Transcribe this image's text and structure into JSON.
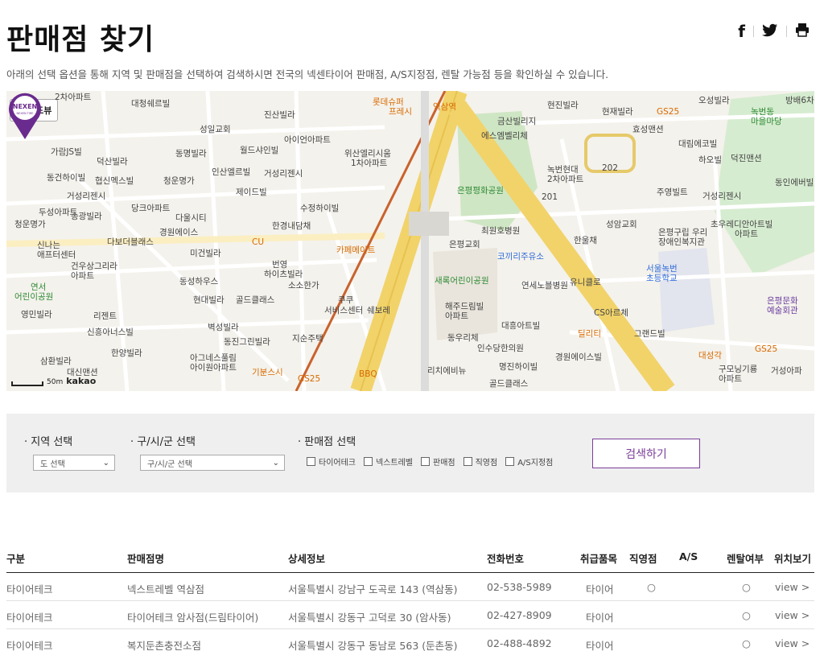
{
  "page": {
    "title": "판매점 찾기",
    "description": "아래의 선택 옵션을 통해 지역 및 판매점을 선택하여 검색하시면 전국의 넥센타이어 판매점, A/S지정점, 렌탈 가능점 등을 확인하실 수 있습니다."
  },
  "share": {
    "facebook": "f",
    "twitter": "🐦",
    "print": "🖶"
  },
  "map": {
    "roadview_label": "로드뷰",
    "scale_text": "50m",
    "map_logo": "kakao",
    "marker_brand": "NEXEN",
    "marker_sub": "NEXEN TIRE",
    "labels": [
      {
        "t": "2차아파트",
        "c": ""
      },
      {
        "t": "대청쉐르빌",
        "c": ""
      },
      {
        "t": "롯데슈퍼",
        "c": "orange"
      },
      {
        "t": "프레시",
        "c": "orange"
      },
      {
        "t": "역삼역",
        "c": "orange"
      },
      {
        "t": "현진빌라",
        "c": ""
      },
      {
        "t": "현재빌라",
        "c": ""
      },
      {
        "t": "GS25",
        "c": "orange"
      },
      {
        "t": "오성빌라",
        "c": ""
      },
      {
        "t": "녹번동",
        "c": "green"
      },
      {
        "t": "마을마당",
        "c": "green"
      },
      {
        "t": "방배6차",
        "c": ""
      },
      {
        "t": "성일교회",
        "c": ""
      },
      {
        "t": "진산빌라",
        "c": ""
      },
      {
        "t": "금산빌리지",
        "c": ""
      },
      {
        "t": "에스엠벨리체",
        "c": ""
      },
      {
        "t": "효성맨션",
        "c": ""
      },
      {
        "t": "대림에코빌",
        "c": ""
      },
      {
        "t": "가람JS빌",
        "c": ""
      },
      {
        "t": "덕산빌라",
        "c": ""
      },
      {
        "t": "동명빌라",
        "c": ""
      },
      {
        "t": "월드샤인빌",
        "c": ""
      },
      {
        "t": "아이언아파트",
        "c": ""
      },
      {
        "t": "위산엘리시움",
        "c": ""
      },
      {
        "t": "1차아파트",
        "c": ""
      },
      {
        "t": "하오빌",
        "c": ""
      },
      {
        "t": "덕진맨션",
        "c": ""
      },
      {
        "t": "동건하이빌",
        "c": ""
      },
      {
        "t": "협신멕스빌",
        "c": ""
      },
      {
        "t": "청운명가",
        "c": ""
      },
      {
        "t": "인산엘르빌",
        "c": ""
      },
      {
        "t": "거성리젠시",
        "c": ""
      },
      {
        "t": "제이드빌",
        "c": ""
      },
      {
        "t": "은평평화공원",
        "c": "green"
      },
      {
        "t": "녹번현대",
        "c": ""
      },
      {
        "t": "2차아파트",
        "c": ""
      },
      {
        "t": "주영빌트",
        "c": ""
      },
      {
        "t": "거성리젠시",
        "c": ""
      },
      {
        "t": "동인에버빌",
        "c": ""
      },
      {
        "t": "거성리젠시",
        "c": ""
      },
      {
        "t": "두성아파트",
        "c": ""
      },
      {
        "t": "당크아파트",
        "c": ""
      },
      {
        "t": "수정하이빌",
        "c": ""
      },
      {
        "t": "송광빌라",
        "c": ""
      },
      {
        "t": "다울시티",
        "c": ""
      },
      {
        "t": "청운명가",
        "c": ""
      },
      {
        "t": "경원에이스",
        "c": ""
      },
      {
        "t": "한경내담채",
        "c": ""
      },
      {
        "t": "최원호병원",
        "c": ""
      },
      {
        "t": "성암교회",
        "c": ""
      },
      {
        "t": "은평구립 우리",
        "c": ""
      },
      {
        "t": "장애인복지관",
        "c": ""
      },
      {
        "t": "초우레디안아트빌",
        "c": ""
      },
      {
        "t": "아파트",
        "c": ""
      },
      {
        "t": "신나는",
        "c": ""
      },
      {
        "t": "애프터센터",
        "c": ""
      },
      {
        "t": "다보더블래스",
        "c": ""
      },
      {
        "t": "CU",
        "c": "orange"
      },
      {
        "t": "카페메이트",
        "c": "orange"
      },
      {
        "t": "은평교회",
        "c": ""
      },
      {
        "t": "한울채",
        "c": ""
      },
      {
        "t": "미건빌라",
        "c": ""
      },
      {
        "t": "코끼리주유소",
        "c": "blue"
      },
      {
        "t": "건우상그리라",
        "c": ""
      },
      {
        "t": "아파트",
        "c": ""
      },
      {
        "t": "번영",
        "c": ""
      },
      {
        "t": "하이츠빌라",
        "c": ""
      },
      {
        "t": "서울녹번",
        "c": "blue"
      },
      {
        "t": "초등학교",
        "c": "blue"
      },
      {
        "t": "연서",
        "c": "green"
      },
      {
        "t": "어린이공원",
        "c": "green"
      },
      {
        "t": "동성하우스",
        "c": ""
      },
      {
        "t": "소소한가",
        "c": ""
      },
      {
        "t": "새록어린이공원",
        "c": "green"
      },
      {
        "t": "연세노블병원",
        "c": ""
      },
      {
        "t": "유니클로",
        "c": ""
      },
      {
        "t": "은평문화",
        "c": "purple"
      },
      {
        "t": "예술회관",
        "c": "purple"
      },
      {
        "t": "영민빌라",
        "c": ""
      },
      {
        "t": "현대빌라",
        "c": ""
      },
      {
        "t": "골드클래스",
        "c": ""
      },
      {
        "t": "쿠쿠",
        "c": ""
      },
      {
        "t": "서비스센터",
        "c": ""
      },
      {
        "t": "쉐보레",
        "c": ""
      },
      {
        "t": "해주드림빌",
        "c": ""
      },
      {
        "t": "아파트",
        "c": ""
      },
      {
        "t": "CS아르체",
        "c": ""
      },
      {
        "t": "리젠트",
        "c": ""
      },
      {
        "t": "벽성빌라",
        "c": ""
      },
      {
        "t": "대흥아트빌",
        "c": ""
      },
      {
        "t": "신흥아너스빌",
        "c": ""
      },
      {
        "t": "동진그린빌라",
        "c": ""
      },
      {
        "t": "지순주택",
        "c": ""
      },
      {
        "t": "동우리체",
        "c": ""
      },
      {
        "t": "딜리티",
        "c": "orange"
      },
      {
        "t": "그랜드빌",
        "c": ""
      },
      {
        "t": "삼환빌라",
        "c": ""
      },
      {
        "t": "한양빌라",
        "c": ""
      },
      {
        "t": "아그네스풀림",
        "c": ""
      },
      {
        "t": "아이원아파트",
        "c": ""
      },
      {
        "t": "인수당한의원",
        "c": ""
      },
      {
        "t": "경원에이스빌",
        "c": ""
      },
      {
        "t": "대성각",
        "c": "orange"
      },
      {
        "t": "GS25",
        "c": "orange"
      },
      {
        "t": "기분스시",
        "c": "orange"
      },
      {
        "t": "BBQ",
        "c": "orange"
      },
      {
        "t": "리치에비뉴",
        "c": ""
      },
      {
        "t": "명진하이빌",
        "c": ""
      },
      {
        "t": "구모닝기룡",
        "c": ""
      },
      {
        "t": "아파트",
        "c": ""
      },
      {
        "t": "거성아파",
        "c": ""
      },
      {
        "t": "대신맨션",
        "c": ""
      },
      {
        "t": "GS25",
        "c": "orange"
      },
      {
        "t": "골드클래스",
        "c": ""
      },
      {
        "t": "202",
        "c": ""
      },
      {
        "t": "201",
        "c": ""
      }
    ]
  },
  "filter": {
    "region_label": "· 지역 선택",
    "region_value": "도 선택",
    "district_label": "· 구/시/군 선택",
    "district_value": "구/시/군 선택",
    "store_label": "· 판매점 선택",
    "checks": [
      "타이어테크",
      "넥스트레벨",
      "판매점",
      "직영점",
      "A/S지정점"
    ],
    "search_button": "검색하기"
  },
  "table": {
    "headers": [
      "구분",
      "판매점명",
      "상세정보",
      "전화번호",
      "취급품목",
      "직영점",
      "A/S",
      "렌탈여부",
      "위치보기"
    ],
    "rows": [
      {
        "type": "타이어테크",
        "name": "넥스트레벨 역삼점",
        "address": "서울특별시 강남구 도곡로 143 (역삼동)",
        "phone": "02-538-5989",
        "item": "타이어",
        "direct": "○",
        "as": "",
        "rental": "○",
        "view": "view >"
      },
      {
        "type": "타이어테크",
        "name": "타이어테크 암사점(드림타이어)",
        "address": "서울특별시 강동구 고덕로 30 (암사동)",
        "phone": "02-427-8909",
        "item": "타이어",
        "direct": "",
        "as": "",
        "rental": "○",
        "view": "view >"
      },
      {
        "type": "타이어테크",
        "name": "복지둔촌충전소점",
        "address": "서울특별시 강동구 동남로 563 (둔촌동)",
        "phone": "02-488-4892",
        "item": "타이어",
        "direct": "",
        "as": "",
        "rental": "○",
        "view": "view >"
      }
    ]
  }
}
